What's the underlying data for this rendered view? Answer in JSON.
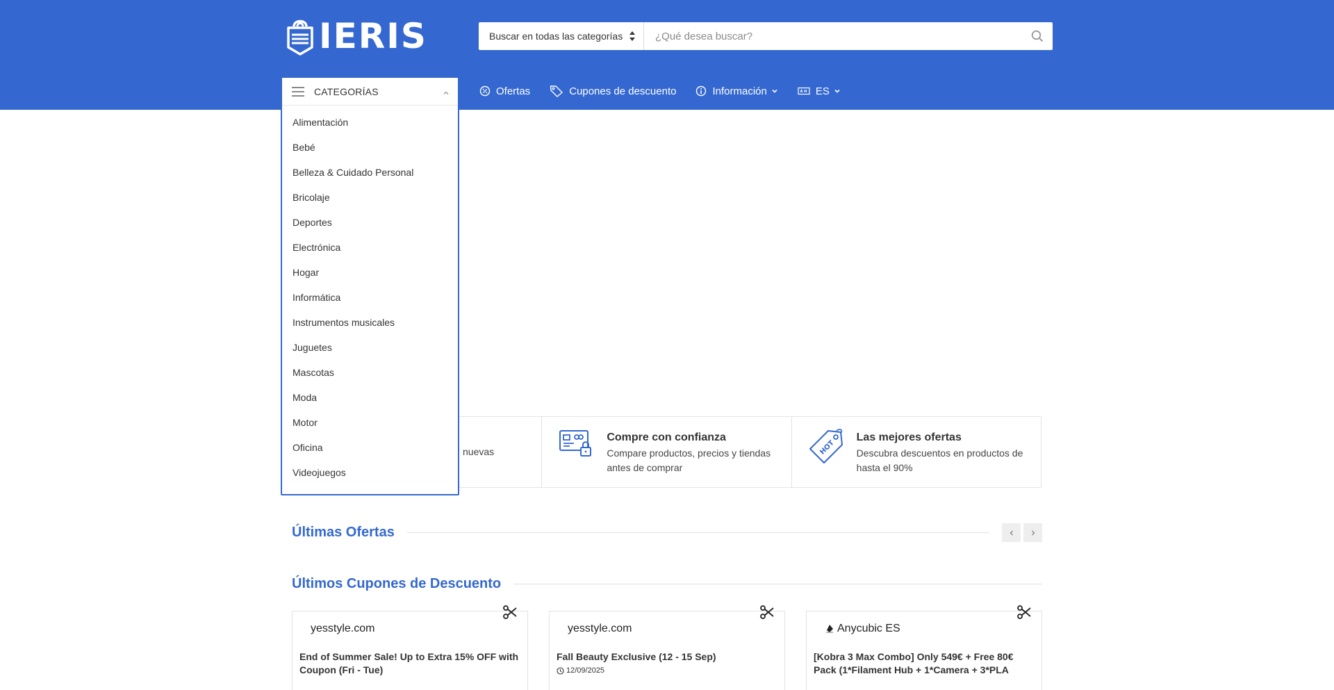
{
  "brand": {
    "name": "IERIS",
    "color": "#3468d0"
  },
  "search": {
    "category_selected": "Buscar en todas las categorías",
    "placeholder": "¿Qué desea buscar?"
  },
  "nav": {
    "categories_label": "CATEGORÍAS",
    "offers_label": "Ofertas",
    "coupons_label": "Cupones de descuento",
    "info_label": "Información",
    "lang_label": "ES"
  },
  "categories": [
    "Alimentación",
    "Bebé",
    "Belleza & Cuidado Personal",
    "Bricolaje",
    "Deportes",
    "Electrónica",
    "Hogar",
    "Informática",
    "Instrumentos musicales",
    "Juguetes",
    "Mascotas",
    "Moda",
    "Motor",
    "Oficina",
    "Videojuegos"
  ],
  "features": [
    {
      "partial_desc": "nuevas"
    },
    {
      "title": "Compre con confianza",
      "desc": "Compare productos, precios y tiendas antes de comprar"
    },
    {
      "title": "Las mejores ofertas",
      "desc": "Descubra descuentos en productos de hasta el 90%"
    }
  ],
  "sections": {
    "latest_offers": "Últimas Ofertas",
    "latest_coupons": "Últimos Cupones de Descuento"
  },
  "coupons": [
    {
      "store": "yesstyle.com",
      "title": "End of Summer Sale! Up to Extra 15% OFF with Coupon (Fri - Tue)",
      "date": ""
    },
    {
      "store": "yesstyle.com",
      "title": "Fall Beauty Exclusive (12 - 15 Sep)",
      "date": "12/09/2025"
    },
    {
      "store": "Anycubic ES",
      "title": "[Kobra 3 Max Combo] Only 549€ + Free 80€ Pack (1*Filament Hub + 1*Camera + 3*PLA",
      "date": ""
    }
  ]
}
